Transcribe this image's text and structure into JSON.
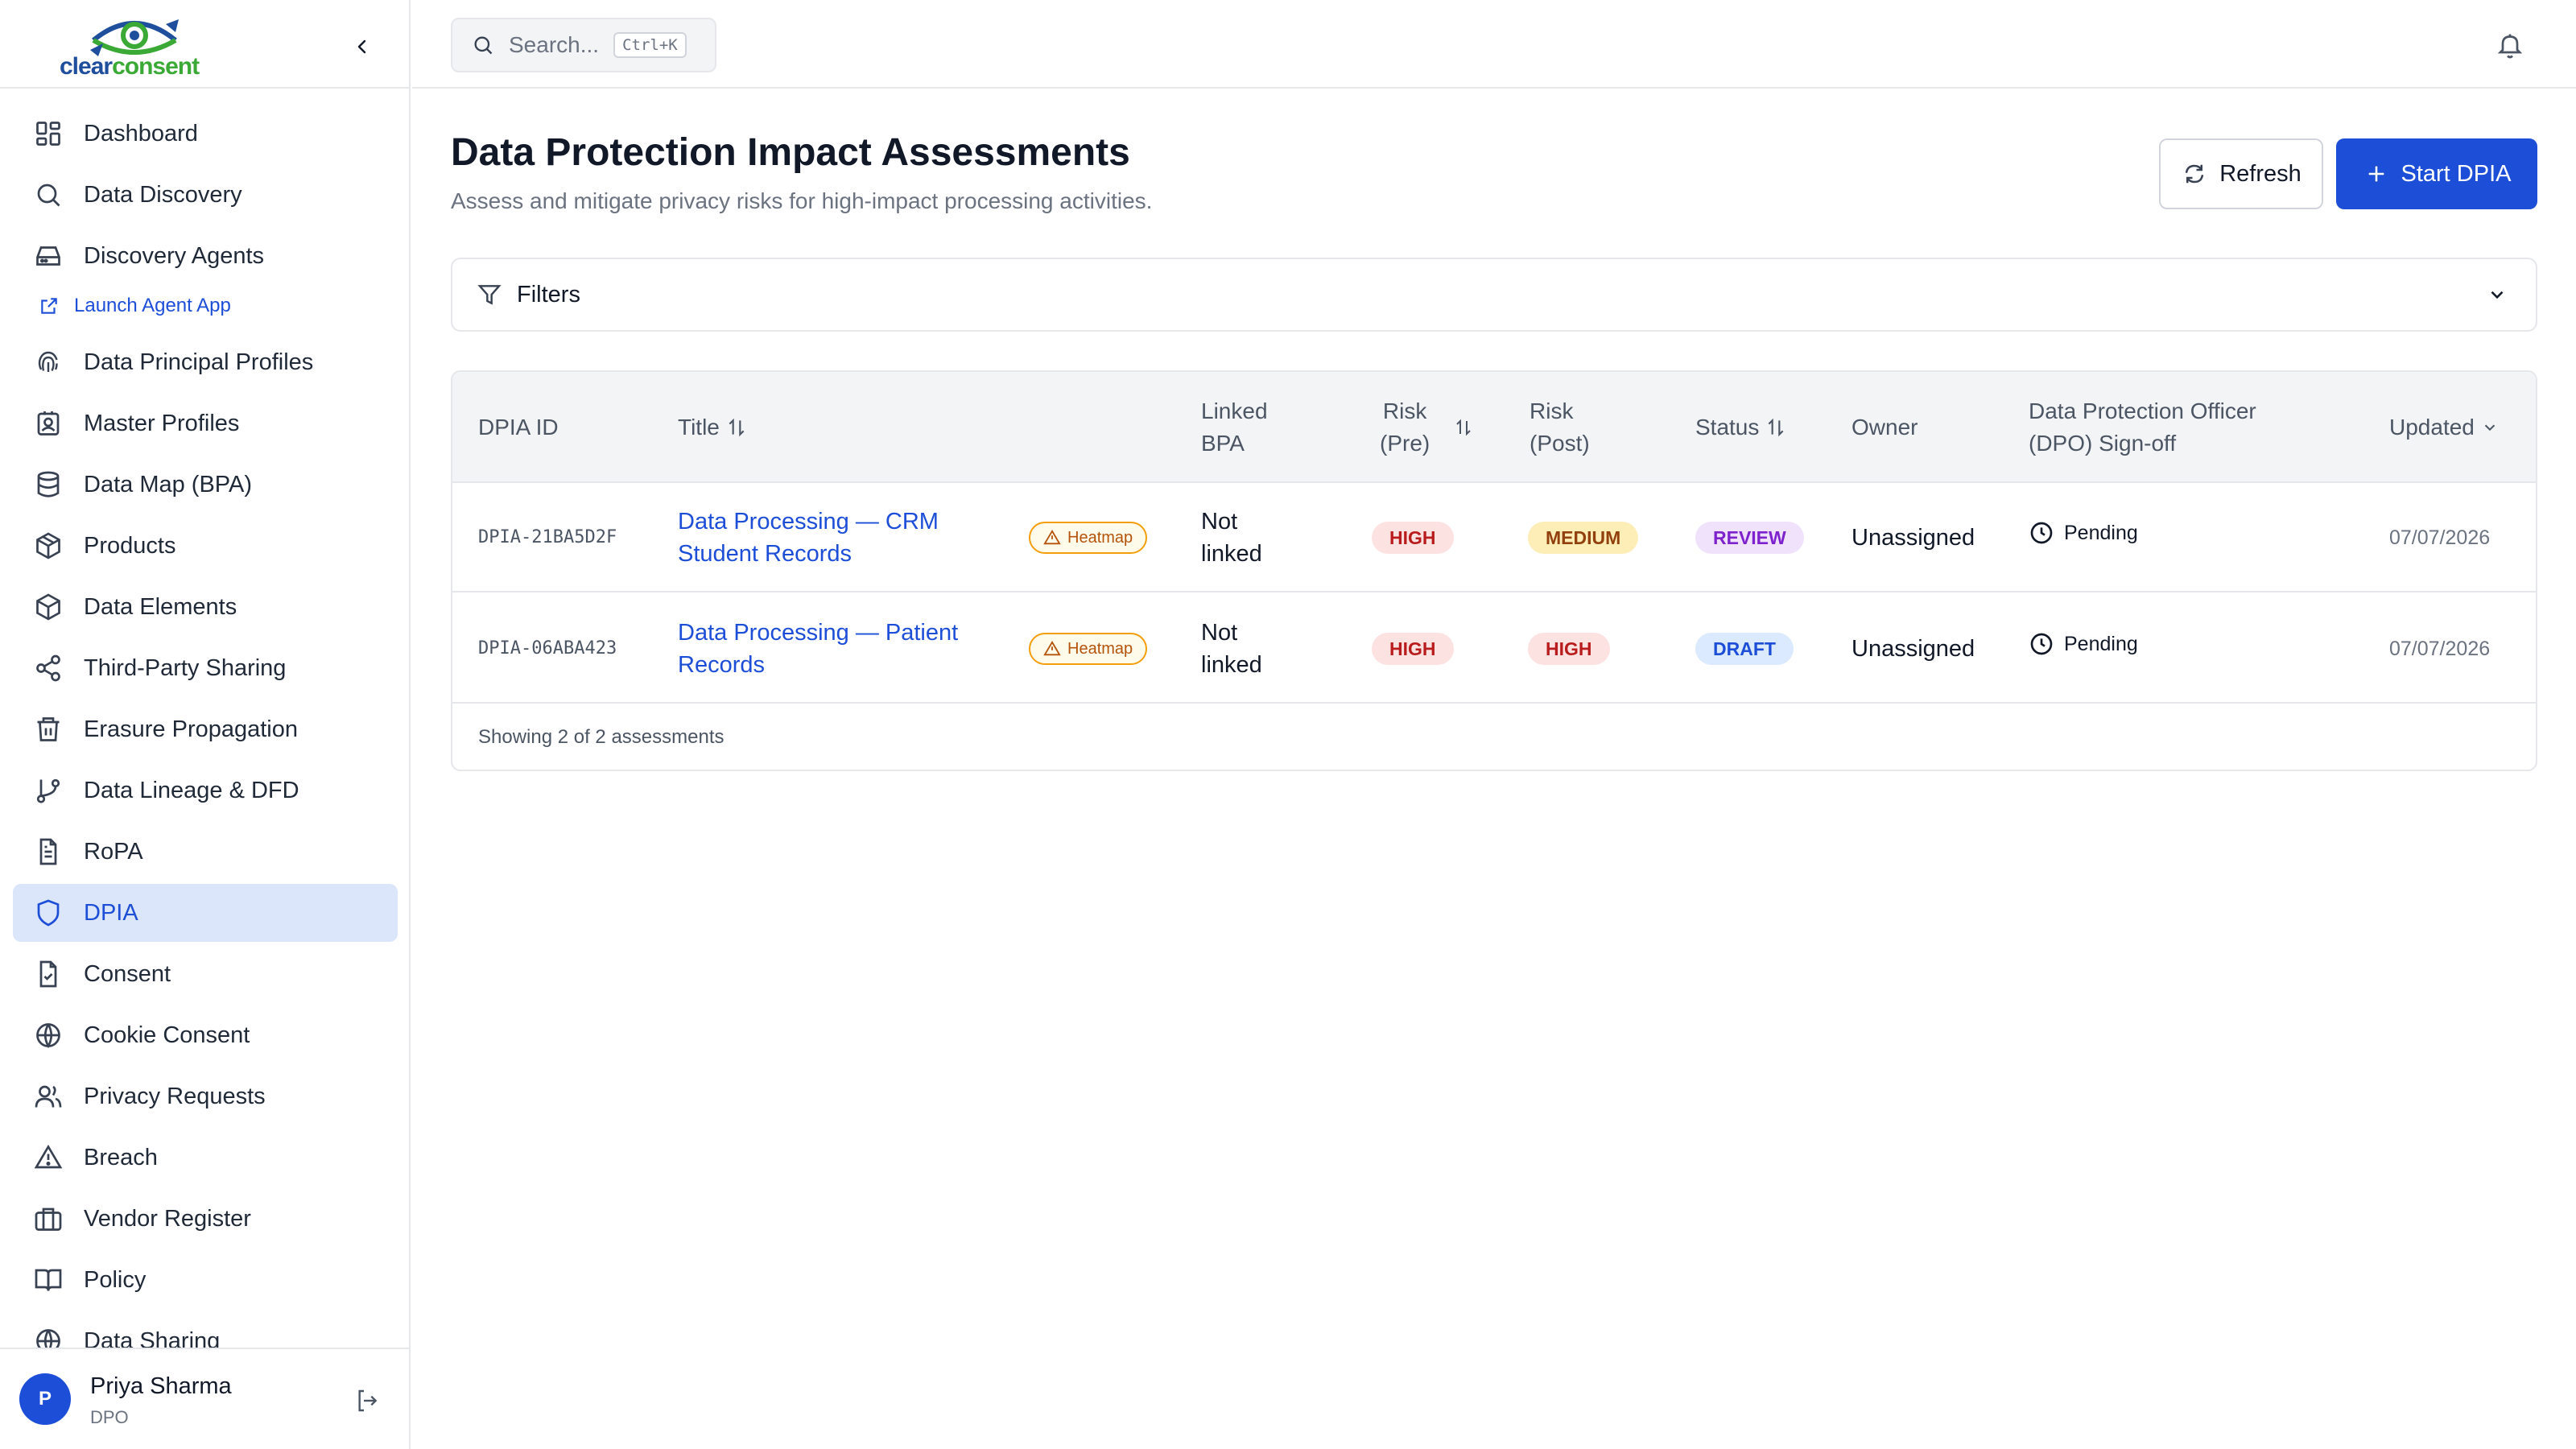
{
  "brand": {
    "name_part1": "clear",
    "name_part2": "consent",
    "primary": "#1f4e9c",
    "secondary": "#3aa935"
  },
  "colors": {
    "accent": "#1d4ed8",
    "active_bg": "#dbe6fb"
  },
  "sidebar": {
    "items": [
      {
        "label": "Dashboard",
        "icon": "grid-icon"
      },
      {
        "label": "Data Discovery",
        "icon": "search-icon"
      },
      {
        "label": "Discovery Agents",
        "icon": "drive-icon"
      },
      {
        "label": "Data Principal Profiles",
        "icon": "fingerprint-icon"
      },
      {
        "label": "Master Profiles",
        "icon": "contact-icon"
      },
      {
        "label": "Data Map (BPA)",
        "icon": "database-icon"
      },
      {
        "label": "Products",
        "icon": "package-icon"
      },
      {
        "label": "Data Elements",
        "icon": "box-icon"
      },
      {
        "label": "Third-Party Sharing",
        "icon": "share-icon"
      },
      {
        "label": "Erasure Propagation",
        "icon": "trash-icon"
      },
      {
        "label": "Data Lineage & DFD",
        "icon": "git-branch-icon"
      },
      {
        "label": "RoPA",
        "icon": "file-text-icon"
      },
      {
        "label": "DPIA",
        "icon": "shield-icon"
      },
      {
        "label": "Consent",
        "icon": "file-check-icon"
      },
      {
        "label": "Cookie Consent",
        "icon": "globe-icon"
      },
      {
        "label": "Privacy Requests",
        "icon": "users-icon"
      },
      {
        "label": "Breach",
        "icon": "alert-triangle-icon"
      },
      {
        "label": "Vendor Register",
        "icon": "briefcase-icon"
      },
      {
        "label": "Policy",
        "icon": "book-icon"
      },
      {
        "label": "Data Sharing",
        "icon": "globe-icon"
      }
    ],
    "sub_link": {
      "label": "Launch Agent App",
      "icon": "external-link-icon"
    },
    "active": "DPIA",
    "user": {
      "initial": "P",
      "name": "Priya Sharma",
      "role": "DPO"
    }
  },
  "topbar": {
    "search_placeholder": "Search...",
    "shortcut": "Ctrl+K"
  },
  "page": {
    "title": "Data Protection Impact Assessments",
    "subtitle": "Assess and mitigate privacy risks for high-impact processing activities.",
    "refresh_label": "Refresh",
    "start_label": "Start DPIA",
    "filters_label": "Filters"
  },
  "table": {
    "headers": {
      "id": "DPIA ID",
      "title": "Title",
      "linked_1": "Linked",
      "linked_2": "BPA",
      "risk_pre_1": "Risk",
      "risk_pre_2": "(Pre)",
      "risk_post_1": "Risk",
      "risk_post_2": "(Post)",
      "status": "Status",
      "owner": "Owner",
      "dpo_1": "Data Protection Officer",
      "dpo_2": "(DPO) Sign-off",
      "updated": "Updated"
    },
    "rows": [
      {
        "id": "DPIA-21BA5D2F",
        "title_1": "Data Processing — CRM",
        "title_2": "Student Records",
        "heatmap": "Heatmap",
        "linked_1": "Not",
        "linked_2": "linked",
        "risk_pre": "HIGH",
        "risk_post": "MEDIUM",
        "status": "REVIEW",
        "owner": "Unassigned",
        "signoff": "Pending",
        "updated": "07/07/2026"
      },
      {
        "id": "DPIA-06ABA423",
        "title_1": "Data Processing — Patient",
        "title_2": "Records",
        "heatmap": "Heatmap",
        "linked_1": "Not",
        "linked_2": "linked",
        "risk_pre": "HIGH",
        "risk_post": "HIGH",
        "status": "DRAFT",
        "owner": "Unassigned",
        "signoff": "Pending",
        "updated": "07/07/2026"
      }
    ],
    "footer": "Showing 2 of 2 assessments"
  }
}
